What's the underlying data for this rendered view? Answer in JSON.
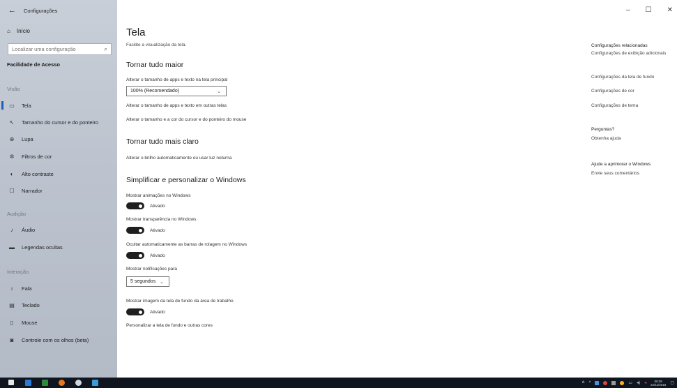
{
  "window": {
    "title": "Configurações",
    "controls": [
      "–",
      "☐",
      "✕"
    ]
  },
  "sidebar": {
    "home_label": "Início",
    "search_placeholder": "Localizar uma configuração",
    "section_title": "Facilidade de Acesso",
    "groups": [
      {
        "title": "Visão",
        "items": [
          {
            "label": "Tela",
            "icon": "monitor-icon",
            "active": true
          },
          {
            "label": "Tamanho do cursor e do ponteiro",
            "icon": "cursor-icon"
          },
          {
            "label": "Lupa",
            "icon": "magnifier-icon"
          },
          {
            "label": "Filtros de cor",
            "icon": "color-filter-icon"
          },
          {
            "label": "Alto contraste",
            "icon": "high-contrast-icon"
          },
          {
            "label": "Narrador",
            "icon": "narrator-icon"
          }
        ]
      },
      {
        "title": "Audição",
        "items": [
          {
            "label": "Áudio",
            "icon": "speaker-icon"
          },
          {
            "label": "Legendas ocultas",
            "icon": "captions-icon"
          }
        ]
      },
      {
        "title": "Interação",
        "items": [
          {
            "label": "Fala",
            "icon": "microphone-icon"
          },
          {
            "label": "Teclado",
            "icon": "keyboard-icon"
          },
          {
            "label": "Mouse",
            "icon": "mouse-icon"
          },
          {
            "label": "Controle com os olhos (beta)",
            "icon": "eye-control-icon"
          }
        ]
      }
    ]
  },
  "main": {
    "title": "Tela",
    "subtitle": "Facilite a visualização da tela.",
    "sections": {
      "bigger": {
        "heading": "Tornar tudo maior",
        "scale_label": "Alterar o tamanho de apps e texto na tela principal",
        "scale_value": "100% (Recomendado)",
        "link_other_screens": "Alterar o tamanho de apps e texto em outras telas",
        "link_cursor": "Alterar o tamanho e a cor do cursor e do ponteiro do mouse"
      },
      "brighter": {
        "heading": "Tornar tudo mais claro",
        "link_brightness": "Alterar o brilho automaticamente ou usar luz noturna"
      },
      "simplify": {
        "heading": "Simplificar e personalizar o Windows",
        "animations_label": "Mostrar animações no Windows",
        "animations_state": "Ativado",
        "transparency_label": "Mostrar transparência no Windows",
        "transparency_state": "Ativado",
        "scrollbars_label": "Ocultar automaticamente as barras de rolagem no Windows",
        "scrollbars_state": "Ativado",
        "notifications_label": "Mostrar notificações para",
        "notifications_value": "5 segundos",
        "wallpaper_label": "Mostrar imagem da tela de fundo da área de trabalho",
        "wallpaper_state": "Ativado",
        "link_personalize": "Personalizar a tela de fundo e outras cores"
      }
    }
  },
  "right_panel": {
    "related_title": "Configurações relacionadas",
    "related_links": [
      "Configurações de exibição adicionais",
      "Configurações da tela de fundo",
      "Configurações de cor",
      "Configurações de tema"
    ],
    "questions_title": "Perguntas?",
    "questions_link": "Obtenha ajuda",
    "improve_title": "Ajude a aprimorar o Windows",
    "improve_link": "Envie seus comentários"
  },
  "taskbar": {
    "time": "08:05",
    "date": "22/11/2018"
  }
}
